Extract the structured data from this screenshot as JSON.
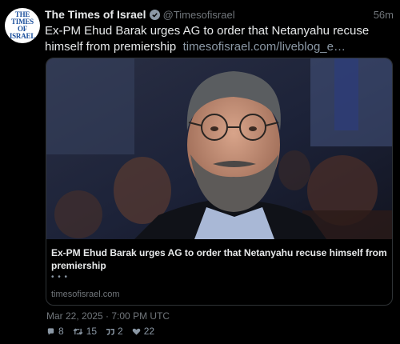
{
  "account": {
    "name": "The Times of Israel",
    "handle": "@Timesofisrael",
    "time_ago": "56m",
    "avatar_lines": [
      "THE TIMES",
      "OF ISRAEL"
    ]
  },
  "tweet": {
    "text": "Ex-PM Ehud Barak urges AG to order that Netanyahu recuse himself from premiership",
    "link": "timesofisrael.com/liveblog_e…"
  },
  "card": {
    "title": "Ex-PM Ehud Barak urges AG to order that Netanyahu recuse himself from premiership",
    "description": "• • •",
    "domain": "timesofisrael.com"
  },
  "timestamp": "Mar 22, 2025 · 7:00 PM UTC",
  "stats": {
    "replies": "8",
    "retweets": "15",
    "quotes": "2",
    "likes": "22"
  },
  "colors": {
    "background": "#000000",
    "text": "#e7e9ea",
    "muted": "#71767b",
    "border": "#2f3336"
  },
  "icons": [
    "verified-badge-icon",
    "reply-icon",
    "retweet-icon",
    "quote-icon",
    "like-icon"
  ]
}
